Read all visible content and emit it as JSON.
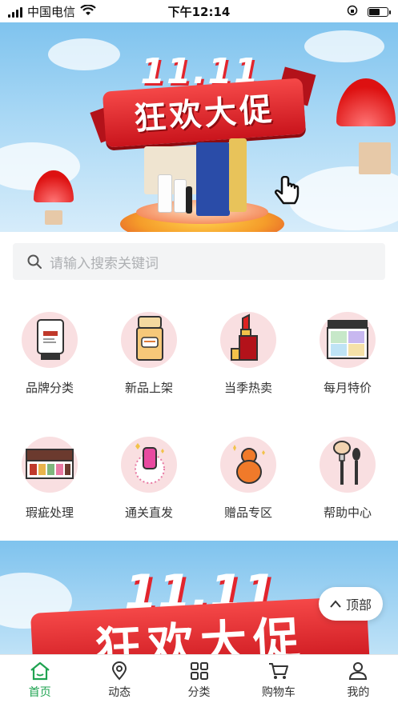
{
  "status_bar": {
    "carrier": "中国电信",
    "time": "下午12:14",
    "battery_level": 0.6
  },
  "banner": {
    "date_title": "11.11",
    "slogan": "狂欢大促",
    "slide_count": 5,
    "active_slide": 1
  },
  "search": {
    "placeholder": "请输入搜索关键词"
  },
  "categories": [
    {
      "label": "品牌分类",
      "icon": "sunscreen-tube-icon"
    },
    {
      "label": "新品上架",
      "icon": "lotion-bottle-icon"
    },
    {
      "label": "当季热卖",
      "icon": "lipstick-icon"
    },
    {
      "label": "每月特价",
      "icon": "palette-compact-icon"
    },
    {
      "label": "瑕疵处理",
      "icon": "eyeshadow-palette-icon"
    },
    {
      "label": "通关直发",
      "icon": "cream-jar-icon"
    },
    {
      "label": "赠品专区",
      "icon": "gourd-sponge-icon"
    },
    {
      "label": "帮助中心",
      "icon": "makeup-brush-icon"
    }
  ],
  "banner2": {
    "date_title": "11.11",
    "slogan": "狂欢大促"
  },
  "to_top": {
    "label": "顶部"
  },
  "tabbar": {
    "items": [
      {
        "label": "首页",
        "icon": "home-icon"
      },
      {
        "label": "动态",
        "icon": "location-pin-icon"
      },
      {
        "label": "分类",
        "icon": "grid-icon"
      },
      {
        "label": "购物车",
        "icon": "cart-icon"
      },
      {
        "label": "我的",
        "icon": "user-icon"
      }
    ],
    "active_index": 0,
    "active_color": "#1fa351"
  },
  "colors": {
    "accent_red": "#d11a22",
    "circle_bg": "#f9dfe1"
  }
}
